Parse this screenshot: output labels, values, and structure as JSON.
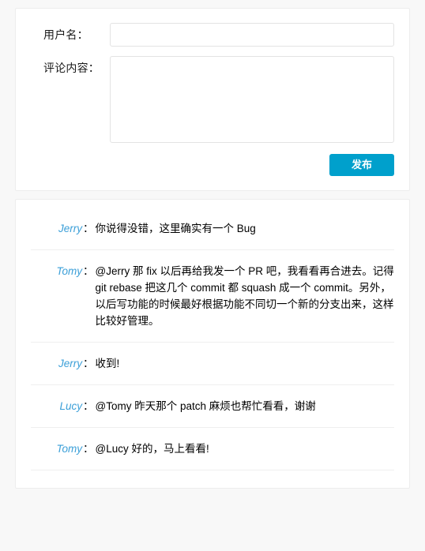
{
  "form": {
    "username": {
      "label": "用户名：",
      "value": "",
      "placeholder": ""
    },
    "content": {
      "label": "评论内容：",
      "value": "",
      "placeholder": ""
    },
    "submit_label": "发布"
  },
  "comments": [
    {
      "author": "Jerry",
      "colon": "：",
      "text": "你说得没错，这里确实有一个 Bug"
    },
    {
      "author": "Tomy",
      "colon": "：",
      "text": "@Jerry 那 fix 以后再给我发一个 PR 吧，我看看再合进去。记得 git rebase 把这几个 commit 都 squash 成一个 commit。另外，以后写功能的时候最好根据功能不同切一个新的分支出来，这样比较好管理。"
    },
    {
      "author": "Jerry",
      "colon": "：",
      "text": "收到!"
    },
    {
      "author": "Lucy",
      "colon": "：",
      "text": "@Tomy 昨天那个 patch 麻烦也帮忙看看，谢谢"
    },
    {
      "author": "Tomy",
      "colon": "：",
      "text": "@Lucy 好的，马上看看!"
    }
  ],
  "colors": {
    "accent": "#00a0cc",
    "author": "#3b9fd8",
    "page_bg": "#f8f8f8",
    "card_bg": "#ffffff",
    "border": "#ededed",
    "divider": "#efefef",
    "input_border": "#e3e3e3"
  }
}
